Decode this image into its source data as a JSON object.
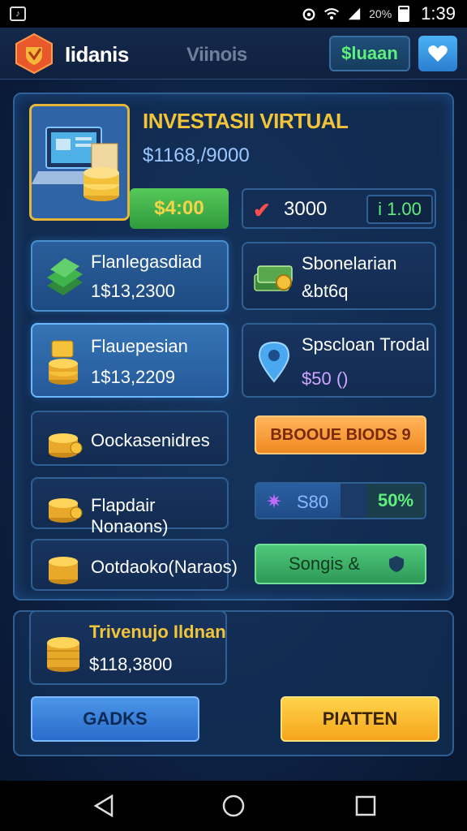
{
  "status_bar": {
    "battery_pct": "20%",
    "time": "1:39"
  },
  "header": {
    "app_name": "Iidanis",
    "subtitle": "Viinois",
    "balance_button": "$luaan"
  },
  "investment": {
    "title": "INVESTASII VIRTUAL",
    "amount": "$1168,/9000",
    "green_pill": "$4:00",
    "check_value": "3000",
    "small_value": "i 1.00"
  },
  "tiles": [
    {
      "label": "Flanlegasdiad",
      "value": "1$13,2300"
    },
    {
      "label": "Sbonelarian",
      "value": "&bt6q"
    },
    {
      "label": "Flauepesian",
      "value": "1$13,2209"
    },
    {
      "label": "Spscloan Trodal",
      "value": "$50 ()"
    },
    {
      "label": "Oockasenidres"
    },
    {
      "label": "Flapdair Nonaons)"
    },
    {
      "label": "Ootdaoko(Naraos)"
    }
  ],
  "actions": {
    "orange_button": "BBOOUE BIODS 9",
    "progress_value": "S80",
    "progress_pct": "50%",
    "progress_fraction": 0.5,
    "green_button": "Songis &"
  },
  "bottom": {
    "balance_title": "Trivenujo Ildnan",
    "balance_amount": "$118,3800",
    "left_button": "GADKS",
    "right_button": "PIATTEN"
  },
  "colors": {
    "accent_gold": "#f2c43a",
    "accent_green": "#5ef07a",
    "panel_border": "#2f5f93",
    "background": "#0e2447"
  },
  "icons": [
    "status-app-icon",
    "alarm-icon",
    "wifi-icon",
    "signal-icon",
    "battery-icon",
    "logo-shield-icon",
    "heart-icon",
    "laptop-icon",
    "checkmark-icon",
    "cash-stack-icon",
    "money-bundle-icon",
    "coin-stack-icon",
    "map-pin-icon",
    "sparkle-icon",
    "shield-icon",
    "back-icon",
    "home-icon",
    "recents-icon"
  ]
}
